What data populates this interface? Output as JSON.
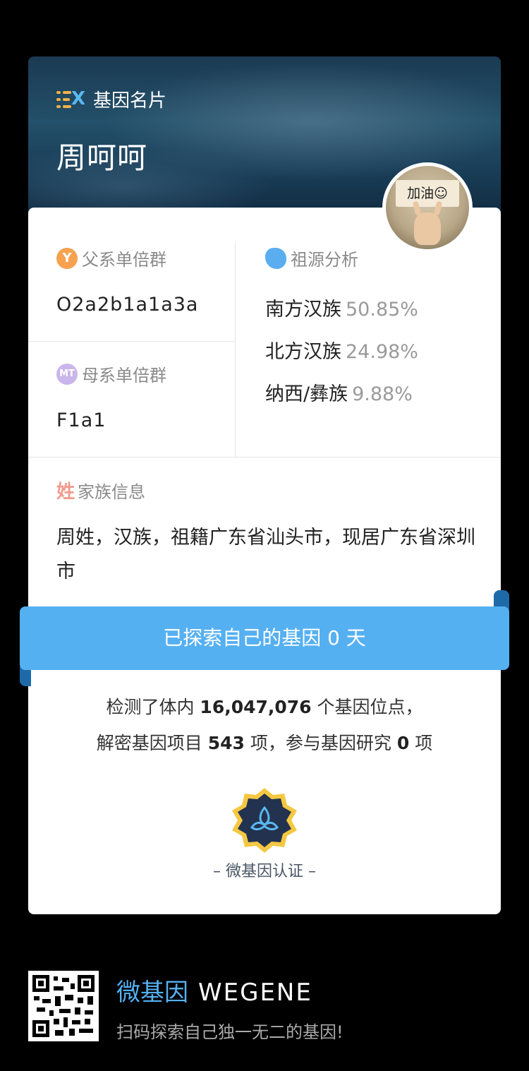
{
  "header": {
    "brand_label": "基因名片",
    "user_name": "周呵呵",
    "avatar_sign_text": "加油☺"
  },
  "paternal": {
    "title": "父系单倍群",
    "badge": "Y",
    "value": "O2a2b1a1a3a"
  },
  "maternal": {
    "title": "母系单倍群",
    "badge": "MT",
    "value": "F1a1"
  },
  "ancestry": {
    "title": "祖源分析",
    "items": [
      {
        "name": "南方汉族",
        "percent": "50.85%"
      },
      {
        "name": "北方汉族",
        "percent": "24.98%"
      },
      {
        "name": "纳西/彝族",
        "percent": "9.88%"
      }
    ]
  },
  "family": {
    "title": "家族信息",
    "badge": "姓",
    "text": "周姓，汉族，祖籍广东省汕头市，现居广东省深圳市"
  },
  "banner": {
    "text": "已探索自己的基因 0 天"
  },
  "stats": {
    "line1_prefix": "检测了体内 ",
    "line1_value": "16,047,076",
    "line1_suffix": " 个基因位点，",
    "line2_prefix": "解密基因项目 ",
    "line2_value1": "543",
    "line2_mid": " 项，参与基因研究 ",
    "line2_value2": "0",
    "line2_suffix": " 项"
  },
  "certification": {
    "label": "– 微基因认证 –"
  },
  "footer": {
    "brand_cn": "微基因",
    "brand_en": "WEGENE",
    "slogan": "扫码探索自己独一无二的基因!"
  },
  "colors": {
    "accent_blue": "#55b0f2",
    "paternal_badge": "#f6a24f",
    "maternal_badge": "#c9b6ea",
    "surname_badge": "#f39a8e",
    "seal_gold": "#f5c842",
    "seal_navy": "#23324f"
  },
  "icons": {
    "brand": "dna-list-icon",
    "paternal": "y-chromosome-badge-icon",
    "maternal": "mt-badge-icon",
    "ancestry": "cloud-icon",
    "family": "surname-icon",
    "seal": "certification-seal-icon",
    "qr": "qr-code-icon"
  }
}
